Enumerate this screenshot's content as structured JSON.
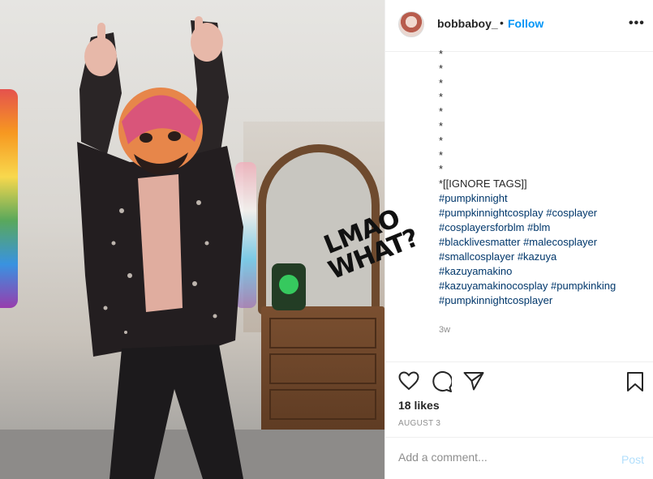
{
  "overlay": {
    "annotation_line1": "LMAO",
    "annotation_line2": "WHAT?"
  },
  "header": {
    "username": "bobbaboy_",
    "separator": "•",
    "follow_label": "Follow",
    "more_label": "•••"
  },
  "caption": {
    "stars": [
      "*",
      "*",
      "*",
      "*",
      "*",
      "*",
      "*",
      "*",
      "*"
    ],
    "ignore_line": "*[[IGNORE TAGS]]",
    "hashtag_lines": [
      [
        "#pumpkinnight"
      ],
      [
        "#pumpkinnightcosplay",
        "#cosplayer"
      ],
      [
        "#cosplayersforblm",
        "#blm"
      ],
      [
        "#blacklivesmatter",
        "#malecosplayer"
      ],
      [
        "#smallcosplayer",
        "#kazuya"
      ],
      [
        "#kazuyamakino"
      ],
      [
        "#kazuyamakinocosplay",
        "#pumpkinking"
      ],
      [
        "#pumpkinnightcosplayer"
      ]
    ],
    "time_ago": "3w"
  },
  "actions": {
    "icons": [
      "heart-icon",
      "comment-icon",
      "share-icon",
      "bookmark-icon"
    ]
  },
  "likes": "18 likes",
  "date": "AUGUST 3",
  "comment": {
    "placeholder": "Add a comment...",
    "post_label": "Post"
  },
  "colors": {
    "follow": "#0095f6",
    "hashtag": "#00376b",
    "annotation_mark": "#e0191f",
    "post_disabled": "#b2dffc"
  }
}
